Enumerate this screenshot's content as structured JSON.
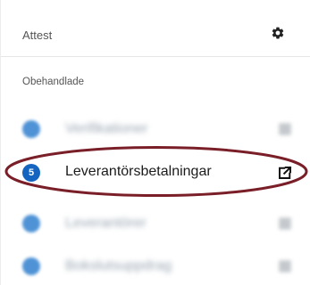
{
  "header": {
    "title": "Attest",
    "settings_icon": "gear-icon"
  },
  "section": {
    "title": "Obehandlade"
  },
  "items": [
    {
      "label": "Verifikationer",
      "badge": "",
      "icon": "external-link-icon",
      "blurred": true
    },
    {
      "label": "Leverantörsbetalningar",
      "badge": "5",
      "icon": "external-link-icon",
      "blurred": false
    },
    {
      "label": "Leverantörer",
      "badge": "",
      "icon": "external-link-icon",
      "blurred": true
    },
    {
      "label": "Bokslutsuppdrag",
      "badge": "",
      "icon": "external-link-icon",
      "blurred": true
    }
  ],
  "colors": {
    "badge_active": "#1565c0",
    "badge_blurred": "#4f93d6",
    "highlight_ring": "#7a1e28"
  }
}
